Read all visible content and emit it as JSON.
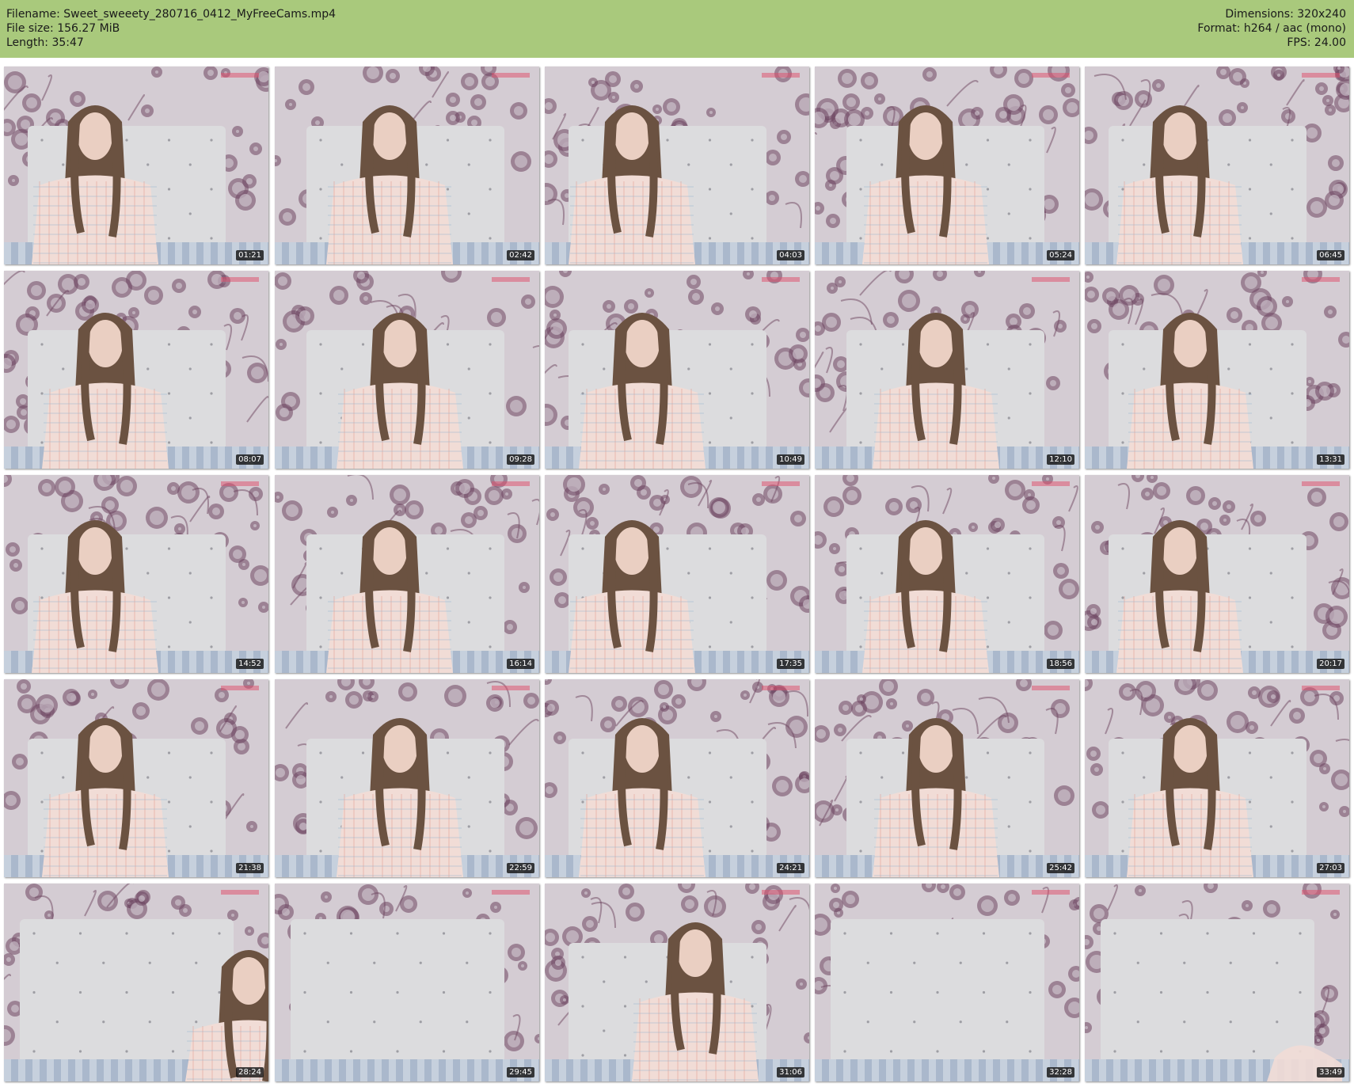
{
  "header": {
    "filename": "Filename: Sweet_sweeety_280716_0412_MyFreeCams.mp4",
    "file_size": "File size: 156.27 MiB",
    "length": "Length: 35:47",
    "dimensions": "Dimensions: 320x240",
    "format": "Format: h264 / aac (mono)",
    "fps": "FPS: 24.00"
  },
  "colors": {
    "header_bg": "#a9c97c",
    "wallpaper": "#d4ccd3",
    "flowers": "#6d4560",
    "headboard": "#dcdcde",
    "shirt": "#f1dcd6",
    "hair": "#6b5241",
    "blanket": "#aab8cc"
  },
  "thumbnails": [
    {
      "time": "01:21",
      "scene": "person"
    },
    {
      "time": "02:42",
      "scene": "person"
    },
    {
      "time": "04:03",
      "scene": "person"
    },
    {
      "time": "05:24",
      "scene": "person"
    },
    {
      "time": "06:45",
      "scene": "person"
    },
    {
      "time": "08:07",
      "scene": "person"
    },
    {
      "time": "09:28",
      "scene": "person"
    },
    {
      "time": "10:49",
      "scene": "person"
    },
    {
      "time": "12:10",
      "scene": "person"
    },
    {
      "time": "13:31",
      "scene": "person"
    },
    {
      "time": "14:52",
      "scene": "person"
    },
    {
      "time": "16:14",
      "scene": "person"
    },
    {
      "time": "17:35",
      "scene": "person"
    },
    {
      "time": "18:56",
      "scene": "person"
    },
    {
      "time": "20:17",
      "scene": "person"
    },
    {
      "time": "21:38",
      "scene": "person"
    },
    {
      "time": "22:59",
      "scene": "person"
    },
    {
      "time": "24:21",
      "scene": "person"
    },
    {
      "time": "25:42",
      "scene": "person"
    },
    {
      "time": "27:03",
      "scene": "person"
    },
    {
      "time": "28:24",
      "scene": "partial-right"
    },
    {
      "time": "29:45",
      "scene": "empty"
    },
    {
      "time": "31:06",
      "scene": "leaning"
    },
    {
      "time": "32:28",
      "scene": "empty"
    },
    {
      "time": "33:49",
      "scene": "empty-cloth"
    }
  ]
}
